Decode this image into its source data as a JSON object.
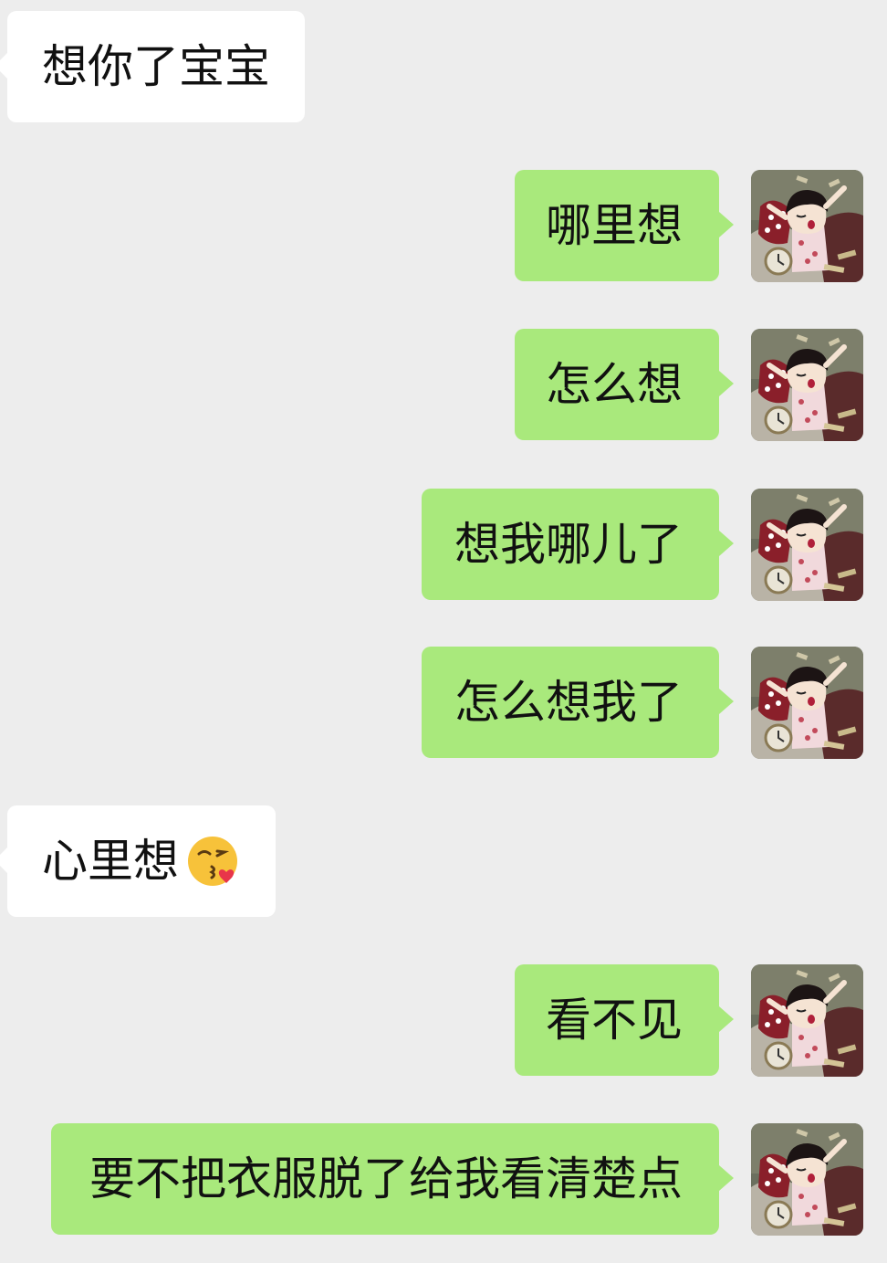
{
  "colors": {
    "background": "#ededed",
    "incoming_bubble": "#ffffff",
    "outgoing_bubble": "#a9e97c",
    "text": "#111111"
  },
  "messages": [
    {
      "side": "left",
      "text": "想你了宝宝"
    },
    {
      "side": "right",
      "text": "哪里想"
    },
    {
      "side": "right",
      "text": "怎么想"
    },
    {
      "side": "right",
      "text": "想我哪儿了"
    },
    {
      "side": "right",
      "text": "怎么想我了"
    },
    {
      "side": "left",
      "text": "心里想",
      "emoji": "face-blowing-a-kiss-emoji"
    },
    {
      "side": "right",
      "text": "看不见"
    },
    {
      "side": "right",
      "text": "要不把衣服脱了给我看清楚点"
    }
  ],
  "avatar": {
    "icon": "cartoon-girl-avatar-icon"
  }
}
